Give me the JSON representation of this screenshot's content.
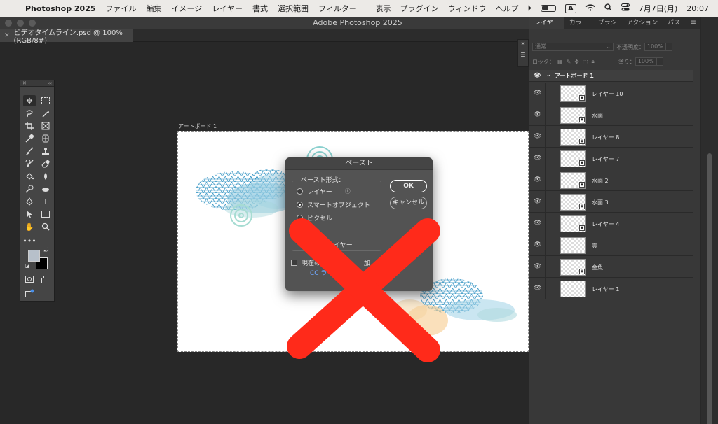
{
  "menubar": {
    "app_name": "Photoshop 2025",
    "menus": [
      "ファイル",
      "編集",
      "イメージ",
      "レイヤー",
      "書式",
      "選択範囲",
      "フィルター"
    ],
    "right_menus": [
      "表示",
      "プラグイン",
      "ウィンドウ",
      "ヘルプ"
    ],
    "input_indicator": "A",
    "date": "7月7日(月)",
    "time": "20:07"
  },
  "window": {
    "title": "Adobe Photoshop 2025",
    "doc_tab": "ビデオタイムライン.psd @ 100% (RGB/8#)"
  },
  "canvas": {
    "artboard_label": "アートボード 1"
  },
  "dialog": {
    "title": "ペースト",
    "group_label": "ペースト形式：",
    "options": [
      "レイヤー",
      "スマートオブジェクト",
      "ピクセル",
      "レイヤー"
    ],
    "selected_option": "スマートオブジェクト",
    "ok_label": "OK",
    "cancel_label": "キャンセル",
    "checkbox_label_visible": "現在の",
    "checkbox_label_tail": "加",
    "link_text": "CC ラ"
  },
  "layers_panel": {
    "tabs": [
      "レイヤー",
      "カラー",
      "ブラシ",
      "アクション",
      "パス"
    ],
    "blend_mode": "通常",
    "opacity_label": "不透明度：",
    "opacity_value": "100%",
    "lock_label": "ロック：",
    "fill_label": "塗り：",
    "fill_value": "100%",
    "artboard_group": "アートボード 1",
    "layers": [
      "レイヤー 10",
      "水面",
      "レイヤー 8",
      "レイヤー 7",
      "水面 2",
      "水面 3",
      "レイヤー 4",
      "雲",
      "金魚",
      "レイヤー 1"
    ]
  },
  "colors": {
    "foreground": "#b7c0ca",
    "background": "#000000",
    "overlay_x": "#ff2a1a"
  }
}
